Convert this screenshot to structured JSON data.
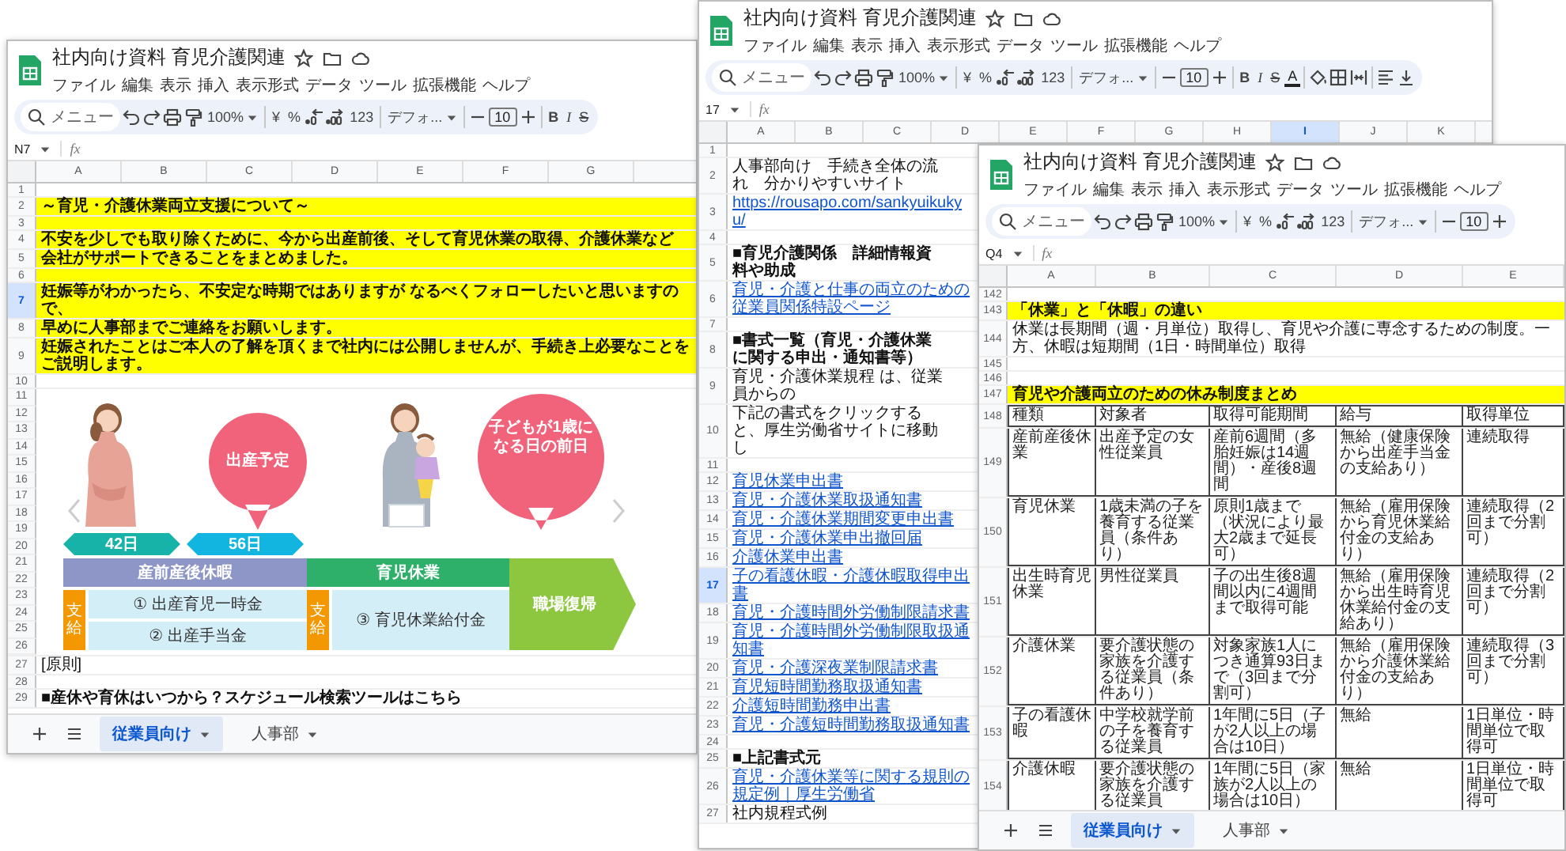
{
  "windows": [
    {
      "title": "社内向け資料 育児介護関連",
      "menus": [
        "ファイル",
        "編集",
        "表示",
        "挿入",
        "表示形式",
        "データ",
        "ツール",
        "拡張機能",
        "ヘルプ"
      ],
      "toolbar": [
        {
          "kind": "search",
          "placeholder": "メニュー"
        },
        {
          "kind": "undo"
        },
        {
          "kind": "redo"
        },
        {
          "kind": "print"
        },
        {
          "kind": "paint"
        },
        {
          "kind": "zoom",
          "text": "100%"
        },
        {
          "kind": "sep"
        },
        {
          "kind": "glyph",
          "text": "¥"
        },
        {
          "kind": "glyph",
          "text": "%"
        },
        {
          "kind": "decimal_less"
        },
        {
          "kind": "decimal_more"
        },
        {
          "kind": "glyph",
          "text": "123"
        },
        {
          "kind": "sep"
        },
        {
          "kind": "font",
          "text": "デフォ..."
        },
        {
          "kind": "sep"
        },
        {
          "kind": "minus"
        },
        {
          "kind": "size",
          "text": "10"
        },
        {
          "kind": "plus"
        },
        {
          "kind": "sep"
        },
        {
          "kind": "bold",
          "text": "B"
        },
        {
          "kind": "italic",
          "text": "I"
        },
        {
          "kind": "strike",
          "text": "S"
        }
      ],
      "cell_ref": "N7",
      "formula_label": "fx",
      "columns": [
        {
          "label": "A",
          "selected": false
        },
        {
          "label": "B",
          "selected": false
        },
        {
          "label": "C",
          "selected": false
        },
        {
          "label": "D",
          "selected": false
        },
        {
          "label": "E",
          "selected": false
        },
        {
          "label": "F",
          "selected": false
        },
        {
          "label": "G",
          "selected": false
        }
      ],
      "rows": [
        {
          "num": "1",
          "selected": false,
          "kind": "empty"
        },
        {
          "num": "2",
          "selected": false,
          "kind": "banner",
          "text": "～育児・介護休業両立支援について～"
        },
        {
          "num": "3",
          "selected": false,
          "kind": "banner"
        },
        {
          "num": "4",
          "selected": false,
          "kind": "banner",
          "text": "不安を少しでも取り除くために、今から出産前後、そして育児休業の取得、介護休業など"
        },
        {
          "num": "5",
          "selected": false,
          "kind": "banner",
          "text": "会社がサポートできることをまとめました。"
        },
        {
          "num": "6",
          "selected": false,
          "kind": "banner"
        },
        {
          "num": "7",
          "selected": true,
          "kind": "banner",
          "text": "妊娠等がわかったら、不安定な時期ではありますが なるべくフォローしたいと思いますので、"
        },
        {
          "num": "8",
          "selected": false,
          "kind": "banner",
          "text": "早めに人事部までご連絡をお願いします。"
        },
        {
          "num": "9",
          "selected": false,
          "kind": "banner",
          "text": "妊娠されたことはご本人の了解を頂くまで社内には公開しませんが、手続き上必要なことをご説明します。"
        },
        {
          "num": "10",
          "selected": false,
          "kind": "empty"
        },
        {
          "kind": "diagram",
          "rows": [
            {
              "num": "11",
              "selected": false
            },
            {
              "num": "12",
              "selected": false
            },
            {
              "num": "13",
              "selected": false
            },
            {
              "num": "14",
              "selected": false
            },
            {
              "num": "15",
              "selected": false
            },
            {
              "num": "16",
              "selected": false
            },
            {
              "num": "17",
              "selected": false
            },
            {
              "num": "18",
              "selected": false
            },
            {
              "num": "19",
              "selected": false
            },
            {
              "num": "20",
              "selected": false
            },
            {
              "num": "21",
              "selected": false
            },
            {
              "num": "22",
              "selected": false
            },
            {
              "num": "23",
              "selected": false
            },
            {
              "num": "24",
              "selected": false
            },
            {
              "num": "25",
              "selected": false
            },
            {
              "num": "26",
              "selected": false
            }
          ],
          "diagram": {
            "prenatal_days": "42日",
            "postnatal_days": "56日",
            "due_date": "出産予定",
            "first_birthday": "子どもが1歳になる日の前日",
            "maternity_leave": "産前産後休暇",
            "childcare_leave": "育児休業",
            "return_to_work": "職場復帰",
            "benefit_tags": [
              "支給",
              "支給"
            ],
            "maternity_benefits": [
              "① 出産育児一時金",
              "② 出産手当金"
            ],
            "childcare_benefit": "③ 育児休業給付金"
          }
        },
        {
          "num": "27",
          "selected": false,
          "kind": "text",
          "bold": false,
          "text": "[原則]"
        },
        {
          "num": "28",
          "selected": false,
          "kind": "empty"
        },
        {
          "num": "29",
          "selected": false,
          "kind": "text",
          "bold": true,
          "text": "■産休や育休はいつから？スケジュール検索ツールはこちら"
        }
      ],
      "tabs": [
        {
          "label": "従業員向け",
          "selected": true
        },
        {
          "label": "人事部",
          "selected": false
        }
      ]
    },
    {
      "title": "社内向け資料 育児介護関連",
      "menus": [
        "ファイル",
        "編集",
        "表示",
        "挿入",
        "表示形式",
        "データ",
        "ツール",
        "拡張機能",
        "ヘルプ"
      ],
      "toolbar": [
        {
          "kind": "search",
          "placeholder": "メニュー"
        },
        {
          "kind": "undo"
        },
        {
          "kind": "redo"
        },
        {
          "kind": "print"
        },
        {
          "kind": "paint"
        },
        {
          "kind": "zoom",
          "text": "100%"
        },
        {
          "kind": "sep"
        },
        {
          "kind": "glyph",
          "text": "¥"
        },
        {
          "kind": "glyph",
          "text": "%"
        },
        {
          "kind": "decimal_less"
        },
        {
          "kind": "decimal_more"
        },
        {
          "kind": "glyph",
          "text": "123"
        },
        {
          "kind": "sep"
        },
        {
          "kind": "font",
          "text": "デフォ..."
        },
        {
          "kind": "sep"
        },
        {
          "kind": "minus"
        },
        {
          "kind": "size",
          "text": "10"
        },
        {
          "kind": "plus"
        },
        {
          "kind": "sep"
        },
        {
          "kind": "bold",
          "text": "B"
        },
        {
          "kind": "italic",
          "text": "I"
        },
        {
          "kind": "strike",
          "text": "S"
        },
        {
          "kind": "text_color",
          "text": "A"
        },
        {
          "kind": "sep"
        },
        {
          "kind": "fill"
        },
        {
          "kind": "borders"
        },
        {
          "kind": "merge"
        },
        {
          "kind": "sep"
        },
        {
          "kind": "align"
        },
        {
          "kind": "valign"
        }
      ],
      "cell_ref": "17",
      "formula_label": "fx",
      "columns": [
        {
          "label": "A",
          "selected": false
        },
        {
          "label": "B",
          "selected": false
        },
        {
          "label": "C",
          "selected": false
        },
        {
          "label": "D",
          "selected": false
        },
        {
          "label": "E",
          "selected": false
        },
        {
          "label": "F",
          "selected": false
        },
        {
          "label": "G",
          "selected": false
        },
        {
          "label": "H",
          "selected": false
        },
        {
          "label": "I",
          "selected": true
        },
        {
          "label": "J",
          "selected": false
        },
        {
          "label": "K",
          "selected": false
        }
      ],
      "rows": [
        {
          "num": "1",
          "selected": false,
          "kind": "empty"
        },
        {
          "num": "2",
          "selected": false,
          "kind": "text",
          "bold": false,
          "text": "人事部向け　手続き全体の流れ　分かりやすいサイト"
        },
        {
          "num": "3",
          "selected": false,
          "kind": "link",
          "text": "https://rousapo.com/sankyuikukyu/"
        },
        {
          "num": "4",
          "selected": false,
          "kind": "empty"
        },
        {
          "num": "5",
          "selected": false,
          "kind": "text",
          "bold": true,
          "text": "■育児介護関係　詳細情報資料や助成"
        },
        {
          "num": "6",
          "selected": false,
          "kind": "link",
          "text": "育児・介護と仕事の両立のための従業員関係特設ページ"
        },
        {
          "num": "7",
          "selected": false,
          "kind": "empty"
        },
        {
          "num": "8",
          "selected": false,
          "kind": "text",
          "bold": true,
          "text": "■書式一覧（育児・介護休業に関する申出・通知書等）"
        },
        {
          "num": "9",
          "selected": false,
          "kind": "text",
          "bold": false,
          "text": "育児・介護休業規程 は、従業員からの"
        },
        {
          "num": "10",
          "selected": false,
          "kind": "text",
          "bold": false,
          "text": "下記の書式をクリックすると、厚生労働省サイトに移動し"
        },
        {
          "num": "11",
          "selected": false,
          "kind": "empty"
        },
        {
          "num": "12",
          "selected": false,
          "kind": "link",
          "text": "育児休業申出書"
        },
        {
          "num": "13",
          "selected": false,
          "kind": "link",
          "text": "育児・介護休業取扱通知書"
        },
        {
          "num": "14",
          "selected": false,
          "kind": "link",
          "text": "育児・介護休業期間変更申出書"
        },
        {
          "num": "15",
          "selected": false,
          "kind": "link",
          "text": "育児・介護休業申出撤回届"
        },
        {
          "num": "16",
          "selected": false,
          "kind": "link",
          "text": "介護休業申出書"
        },
        {
          "num": "17",
          "selected": true,
          "kind": "link",
          "text": "子の看護休暇・介護休暇取得申出書"
        },
        {
          "num": "18",
          "selected": false,
          "kind": "link",
          "text": "育児・介護時間外労働制限請求書"
        },
        {
          "num": "19",
          "selected": false,
          "kind": "link",
          "text": "育児・介護時間外労働制限取扱通知書"
        },
        {
          "num": "20",
          "selected": false,
          "kind": "link",
          "text": "育児・介護深夜業制限請求書"
        },
        {
          "num": "21",
          "selected": false,
          "kind": "link",
          "text": "育児短時間勤務取扱通知書"
        },
        {
          "num": "22",
          "selected": false,
          "kind": "link",
          "text": "介護短時間勤務申出書"
        },
        {
          "num": "23",
          "selected": false,
          "kind": "link",
          "text": "育児・介護短時間勤務取扱通知書"
        },
        {
          "num": "24",
          "selected": false,
          "kind": "empty"
        },
        {
          "num": "25",
          "selected": false,
          "kind": "text",
          "bold": true,
          "text": "■上記書式元"
        },
        {
          "num": "26",
          "selected": false,
          "kind": "link",
          "text": "育児・介護休業等に関する規則の規定例｜厚生労働省"
        },
        {
          "num": "27",
          "selected": false,
          "kind": "text",
          "bold": false,
          "text": "社内規程式例"
        }
      ]
    },
    {
      "title": "社内向け資料 育児介護関連",
      "menus": [
        "ファイル",
        "編集",
        "表示",
        "挿入",
        "表示形式",
        "データ",
        "ツール",
        "拡張機能",
        "ヘルプ"
      ],
      "toolbar": [
        {
          "kind": "search",
          "placeholder": "メニュー"
        },
        {
          "kind": "undo"
        },
        {
          "kind": "redo"
        },
        {
          "kind": "print"
        },
        {
          "kind": "paint"
        },
        {
          "kind": "zoom",
          "text": "100%"
        },
        {
          "kind": "sep"
        },
        {
          "kind": "glyph",
          "text": "¥"
        },
        {
          "kind": "glyph",
          "text": "%"
        },
        {
          "kind": "decimal_less"
        },
        {
          "kind": "decimal_more"
        },
        {
          "kind": "glyph",
          "text": "123"
        },
        {
          "kind": "sep"
        },
        {
          "kind": "font",
          "text": "デフォ..."
        },
        {
          "kind": "sep"
        },
        {
          "kind": "minus"
        },
        {
          "kind": "size",
          "text": "10"
        },
        {
          "kind": "plus"
        }
      ],
      "cell_ref": "Q4",
      "formula_label": "fx",
      "columns": [
        {
          "label": "A",
          "selected": false
        },
        {
          "label": "B",
          "selected": false
        },
        {
          "label": "C",
          "selected": false
        },
        {
          "label": "D",
          "selected": false
        },
        {
          "label": "E",
          "selected": false
        }
      ],
      "rows": [
        {
          "num": "142",
          "selected": false,
          "kind": "empty"
        },
        {
          "num": "143",
          "selected": false,
          "kind": "banner",
          "text": "「休業」と「休暇」の違い"
        },
        {
          "num": "144",
          "selected": false,
          "kind": "text",
          "bold": false,
          "text": "休業は長期間（週・月単位）取得し、育児や介護に専念するための制度。一方、休暇は短期間（1日・時間単位）取得"
        },
        {
          "num": "145",
          "selected": false,
          "kind": "empty"
        },
        {
          "num": "146",
          "selected": false,
          "kind": "empty"
        },
        {
          "num": "147",
          "selected": false,
          "kind": "banner",
          "text": "育児や介護両立のための休み制度まとめ"
        },
        {
          "num": "148",
          "selected": false,
          "kind": "table_header",
          "cells": [
            "種類",
            "対象者",
            "取得可能期間",
            "給与",
            "取得単位"
          ]
        },
        {
          "num": "149",
          "selected": false,
          "kind": "table_row",
          "cells": [
            "産前産後休業",
            "出産予定の女性従業員",
            "産前6週間（多胎妊娠は14週間）・産後8週間",
            "無給（健康保険から出産手当金の支給あり）",
            "連続取得"
          ]
        },
        {
          "num": "150",
          "selected": false,
          "kind": "table_row",
          "cells": [
            "育児休業",
            "1歳未満の子を養育する従業員（条件あり）",
            "原則1歳まで（状況により最大2歳まで延長可）",
            "無給（雇用保険から育児休業給付金の支給あり）",
            "連続取得（2回まで分割可）"
          ]
        },
        {
          "num": "151",
          "selected": false,
          "kind": "table_row",
          "cells": [
            "出生時育児休業",
            "男性従業員",
            "子の出生後8週間以内に4週間まで取得可能",
            "無給（雇用保険から出生時育児休業給付金の支給あり）",
            "連続取得（2回まで分割可）"
          ]
        },
        {
          "num": "152",
          "selected": false,
          "kind": "table_row",
          "cells": [
            "介護休業",
            "要介護状態の家族を介護する従業員（条件あり）",
            "対象家族1人につき通算93日まで（3回まで分割可）",
            "無給（雇用保険から介護休業給付金の支給あり）",
            "連続取得（3回まで分割可）"
          ]
        },
        {
          "num": "153",
          "selected": false,
          "kind": "table_row",
          "cells": [
            "子の看護休暇",
            "中学校就学前の子を養育する従業員",
            "1年間に5日（子が2人以上の場合は10日）",
            "無給",
            "1日単位・時間単位で取得可"
          ]
        },
        {
          "num": "154",
          "selected": false,
          "kind": "table_row",
          "cells": [
            "介護休暇",
            "要介護状態の家族を介護する従業員",
            "1年間に5日（家族が2人以上の場合は10日）",
            "無給",
            "1日単位・時間単位で取得可"
          ]
        }
      ],
      "tabs": [
        {
          "label": "従業員向け",
          "selected": true
        },
        {
          "label": "人事部",
          "selected": false
        }
      ]
    }
  ]
}
